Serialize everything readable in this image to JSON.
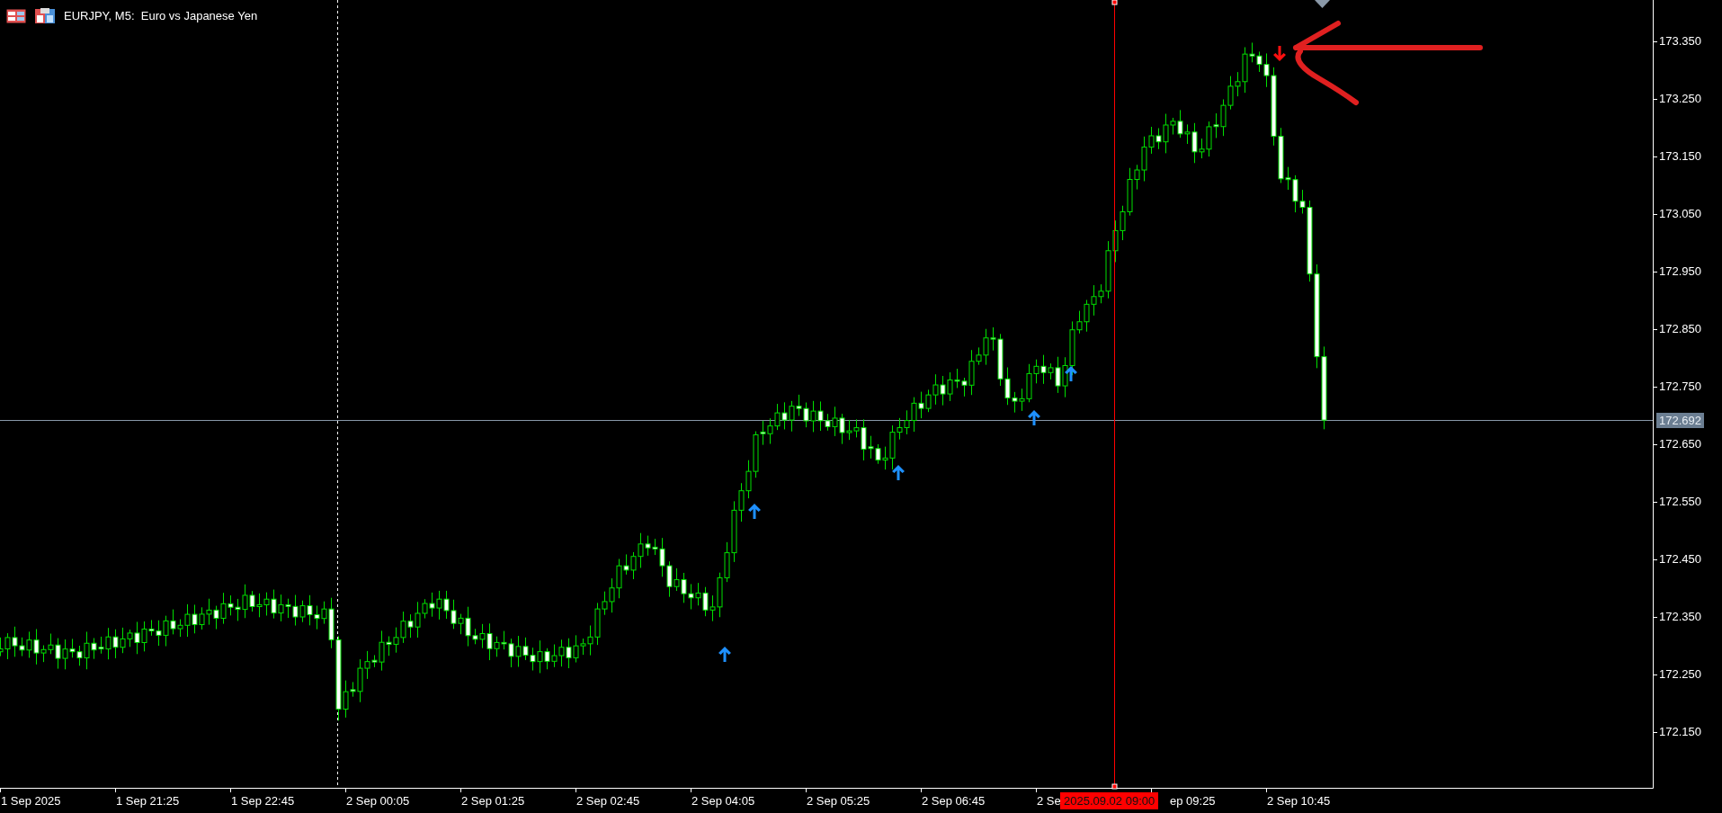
{
  "chart": {
    "title": "EURJPY, M5:  Euro vs Japanese Yen",
    "price_ticks": [
      "173.350",
      "173.250",
      "173.150",
      "173.050",
      "172.950",
      "172.850",
      "172.750",
      "172.650",
      "172.550",
      "172.450",
      "172.350",
      "172.250",
      "172.150"
    ],
    "current_price": "172.692",
    "time_labels": [
      "1 Sep 2025",
      "1 Sep 21:25",
      "1 Sep 22:45",
      "2 Sep 00:05",
      "2 Sep 01:25",
      "2 Sep 02:45",
      "2 Sep 04:05",
      "2 Sep 05:25",
      "2 Sep 06:45",
      "2 Se",
      "ep 09:25",
      "2 Sep 10:45"
    ],
    "cursor_time": "2025.09.02 09:00"
  }
}
